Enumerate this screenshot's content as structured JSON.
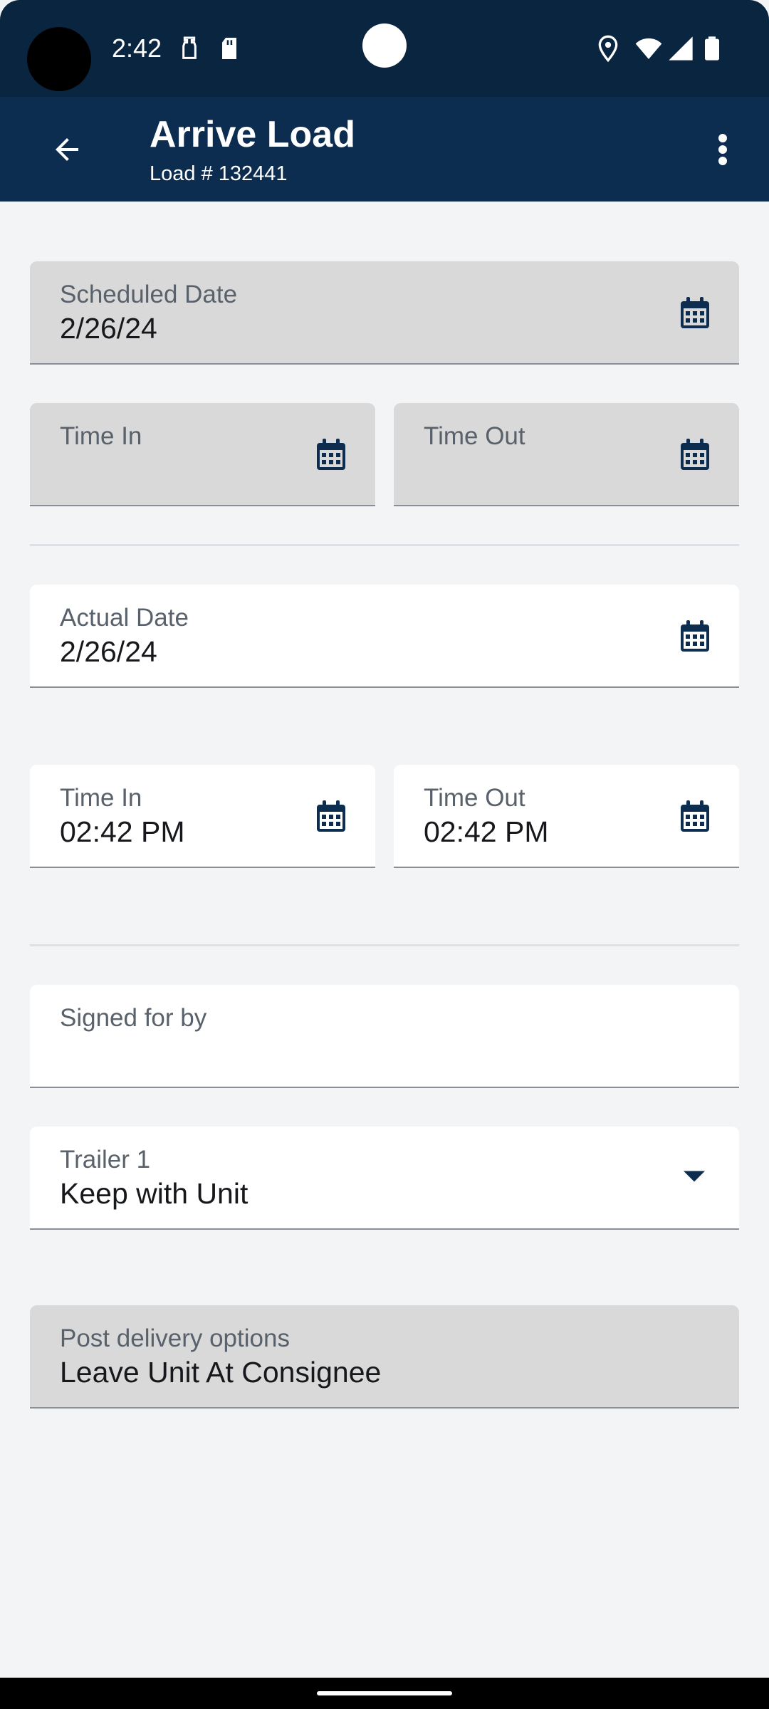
{
  "status_bar": {
    "time": "2:42",
    "left_icons": [
      "hand-sanitizer-icon",
      "sd-card-icon"
    ],
    "right_icons": [
      "location-icon",
      "wifi-icon",
      "signal-icon",
      "battery-icon"
    ]
  },
  "app_bar": {
    "title": "Arrive Load",
    "subtitle": "Load # 132441",
    "back_icon": "arrow-back-icon",
    "menu_icon": "more-vert-icon"
  },
  "scheduled": {
    "date": {
      "label": "Scheduled Date",
      "value": "2/26/24"
    },
    "time_in": {
      "label": "Time In",
      "value": ""
    },
    "time_out": {
      "label": "Time Out",
      "value": ""
    }
  },
  "actual": {
    "date": {
      "label": "Actual Date",
      "value": "2/26/24"
    },
    "time_in": {
      "label": "Time In",
      "value": "02:42 PM"
    },
    "time_out": {
      "label": "Time Out",
      "value": "02:42 PM"
    }
  },
  "signed_for_by": {
    "label": "Signed for by",
    "value": ""
  },
  "trailer": {
    "label": "Trailer 1",
    "value": "Keep with Unit"
  },
  "post_delivery": {
    "label": "Post delivery options",
    "value": "Leave Unit At Consignee"
  },
  "colors": {
    "status_bar": "#0a2540",
    "app_bar": "#0c2d4f",
    "icon": "#0c2d4f",
    "disabled_field": "#d9d9d9",
    "background": "#f3f4f6"
  }
}
